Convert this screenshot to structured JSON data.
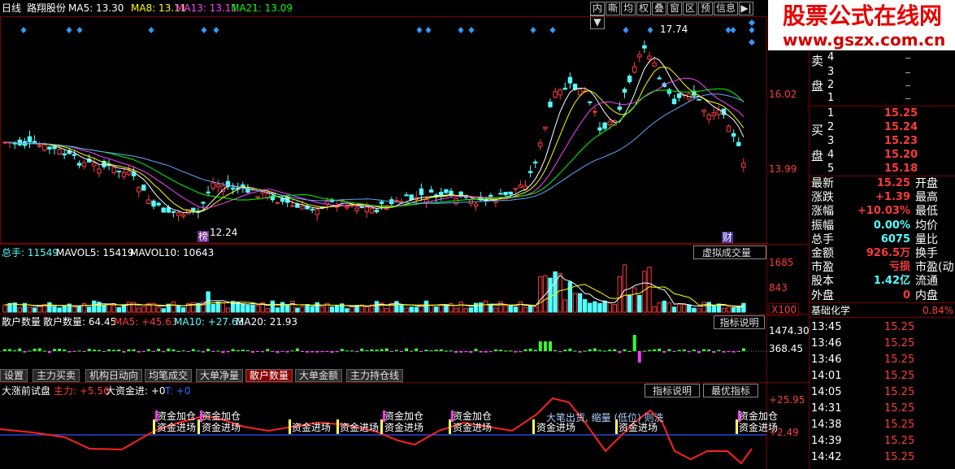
{
  "header": {
    "period": "日线",
    "stock_name": "路翔股份",
    "ma5": "MA5: 13.30",
    "ma8": "MA8: 13.11",
    "ma13": "MA13: 13.11",
    "ma21": "MA21: 13.09",
    "toolbar": [
      "内",
      "嘶",
      "均",
      "权",
      "叠",
      "窗",
      "区",
      "预",
      "信息",
      "▶|",
      "▼"
    ]
  },
  "watermark": {
    "line1": "股票公式在线网",
    "line2": "www.gszx.com.cn"
  },
  "price_chart": {
    "high_label": "17.74",
    "low_label": "12.24",
    "axis": [
      "16.02",
      "13.99"
    ],
    "mark_bang": "榜",
    "mark_cai": "财"
  },
  "volume_panel": {
    "title": "总手: 11549",
    "mavol5": "MAVOL5: 15419",
    "mavol10": "MAVOL10: 10643",
    "dropdown": "虚拟成交量",
    "axis": [
      "1685",
      "843",
      "X100"
    ]
  },
  "retail_panel": {
    "title": "散户数量",
    "value": "散户数量: 64.45",
    "ma5": "MA5: +45.63",
    "ma10": "MA10: +27.63",
    "ma20": "MA20: 21.93",
    "help": "指标说明",
    "axis": [
      "1474.30",
      "368.45"
    ]
  },
  "tabs": [
    "设置",
    "主力买卖",
    "机构日动向",
    "均笔成交",
    "大单净量",
    "散户数量",
    "大单金额",
    "主力持仓线"
  ],
  "bottom_panel": {
    "title": "大涨前试盘",
    "zhuli": "主力: +5.56",
    "dazijin": "大资金进: +0",
    "t": "T: +0",
    "help": "指标说明",
    "best": "最优指标",
    "axis": [
      "+25.95",
      "+2.49"
    ],
    "annot_add": "资金加仓",
    "annot_enter": "资金进场",
    "annot_mid": "大笔出货, 缩量 (低位) 则洗"
  },
  "order_book": {
    "sell_label_1": "卖",
    "sell_label_2": "盘",
    "buy_label_1": "买",
    "buy_label_2": "盘",
    "sell": [
      {
        "n": "4",
        "p": "",
        "v": ""
      },
      {
        "n": "3",
        "p": "",
        "v": ""
      },
      {
        "n": "2",
        "p": "",
        "v": ""
      },
      {
        "n": "1",
        "p": "",
        "v": ""
      }
    ],
    "buy": [
      {
        "n": "1",
        "p": "15.25"
      },
      {
        "n": "2",
        "p": "15.24"
      },
      {
        "n": "3",
        "p": "15.23"
      },
      {
        "n": "4",
        "p": "15.20"
      },
      {
        "n": "5",
        "p": "15.18"
      }
    ]
  },
  "stats": [
    {
      "l": "最新",
      "v": "15.25",
      "r": "开盘"
    },
    {
      "l": "涨跌",
      "v": "+1.39",
      "r": "最高"
    },
    {
      "l": "涨幅",
      "v": "+10.03%",
      "r": "最低"
    },
    {
      "l": "振幅",
      "v": "0.00%",
      "r": "均价"
    },
    {
      "l": "总手",
      "v": "6075",
      "r": "量比"
    },
    {
      "l": "金额",
      "v": "926.5万",
      "r": "换手"
    },
    {
      "l": "市盈",
      "v": "亏损",
      "r": "市盈(动"
    },
    {
      "l": "股本",
      "v": "1.42亿",
      "r": "流通"
    },
    {
      "l": "外盘",
      "v": "0",
      "r": "内盘"
    }
  ],
  "sector": {
    "name": "基础化学",
    "change": "0.84%"
  },
  "ticks": [
    {
      "t": "13:45",
      "p": "15.25"
    },
    {
      "t": "13:46",
      "p": "15.25"
    },
    {
      "t": "13:46",
      "p": "15.25"
    },
    {
      "t": "14:01",
      "p": "15.25"
    },
    {
      "t": "14:05",
      "p": "15.25"
    },
    {
      "t": "14:31",
      "p": "15.25"
    },
    {
      "t": "14:38",
      "p": "15.25"
    },
    {
      "t": "14:39",
      "p": "15.25"
    },
    {
      "t": "14:42",
      "p": "15.25"
    }
  ],
  "colors": {
    "up": "#ff3b3b",
    "down": "#54ffff",
    "ma5": "#ffffff",
    "ma8": "#ffff00",
    "ma13": "#ff00ff",
    "ma21": "#00ff00"
  }
}
